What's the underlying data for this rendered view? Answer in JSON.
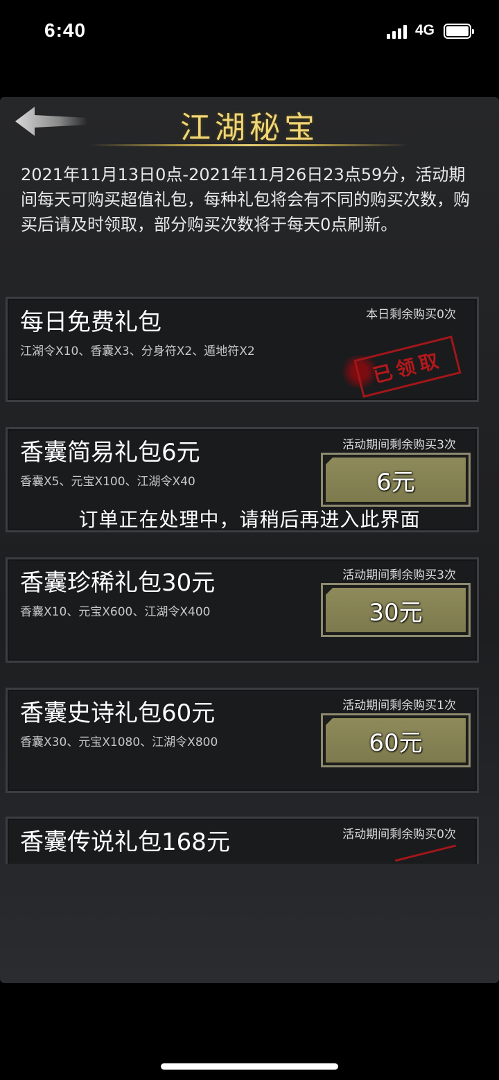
{
  "status_bar": {
    "time": "6:40",
    "network": "4G"
  },
  "header": {
    "title": "江湖秘宝"
  },
  "description": "2021年11月13日0点-2021年11月26日23点59分，活动期间每天可购买超值礼包，每种礼包将会有不同的购买次数，购买后请及时领取，部分购买次数将于每天0点刷新。",
  "packages": [
    {
      "title": "每日免费礼包",
      "limit": "本日剩余购买0次",
      "items": "江湖令X10、香囊X3、分身符X2、遁地符X2",
      "stamp": "已领取"
    },
    {
      "title": "香囊简易礼包6元",
      "limit": "活动期间剩余购买3次",
      "items": "香囊X5、元宝X100、江湖令X40",
      "button": "6元"
    },
    {
      "title": "香囊珍稀礼包30元",
      "limit": "活动期间剩余购买3次",
      "items": "香囊X10、元宝X600、江湖令X400",
      "button": "30元"
    },
    {
      "title": "香囊史诗礼包60元",
      "limit": "活动期间剩余购买1次",
      "items": "香囊X30、元宝X1080、江湖令X800",
      "button": "60元"
    },
    {
      "title": "香囊传说礼包168元",
      "limit": "活动期间剩余购买0次"
    }
  ],
  "toast": "订单正在处理中，请稍后再进入此界面",
  "colors": {
    "title_gold": "#f1d678",
    "button_olive": "#8e8a5b",
    "stamp_red": "#a1161a"
  }
}
